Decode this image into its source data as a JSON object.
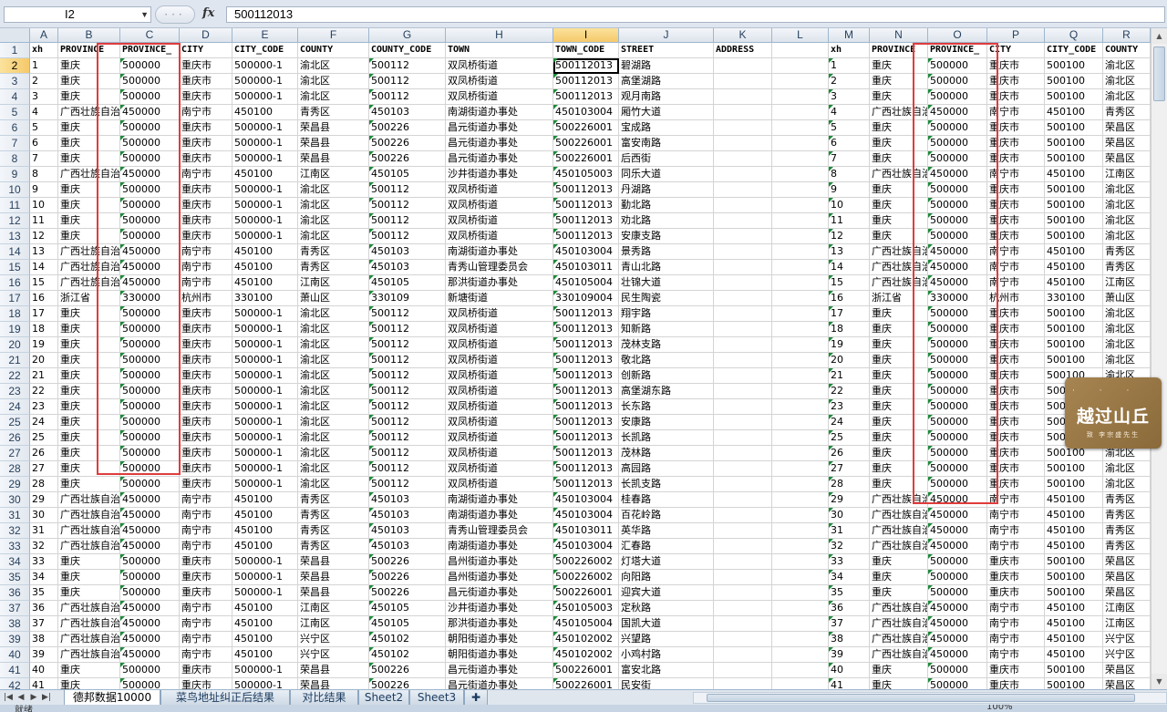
{
  "formula_bar": {
    "name_box": "I2",
    "fx": "fx",
    "formula": "500112013"
  },
  "columns_left": [
    "A",
    "B",
    "C",
    "D",
    "E",
    "F",
    "G",
    "H",
    "I",
    "J",
    "K",
    "L"
  ],
  "columns_right": [
    "M",
    "N",
    "O",
    "P",
    "Q",
    "R"
  ],
  "left_headers": [
    "xh",
    "PROVINCE",
    "PROVINCE_",
    "CITY",
    "CITY_CODE",
    "COUNTY",
    "COUNTY_CODE",
    "TOWN",
    "TOWN_CODE",
    "STREET",
    "ADDRESS",
    ""
  ],
  "right_headers": [
    "xh",
    "PROVINCE",
    "PROVINCE_",
    "CITY",
    "CITY_CODE",
    "COUNTY"
  ],
  "rows_left": [
    [
      "1",
      "重庆",
      "500000",
      "重庆市",
      "500000-1",
      "渝北区",
      "500112",
      "双凤桥街道",
      "500112013",
      "碧湖路"
    ],
    [
      "2",
      "重庆",
      "500000",
      "重庆市",
      "500000-1",
      "渝北区",
      "500112",
      "双凤桥街道",
      "500112013",
      "高堡湖路"
    ],
    [
      "3",
      "重庆",
      "500000",
      "重庆市",
      "500000-1",
      "渝北区",
      "500112",
      "双凤桥街道",
      "500112013",
      "观月南路"
    ],
    [
      "4",
      "广西壮族自治区",
      "450000",
      "南宁市",
      "450100",
      "青秀区",
      "450103",
      "南湖街道办事处",
      "450103004",
      "厢竹大道"
    ],
    [
      "5",
      "重庆",
      "500000",
      "重庆市",
      "500000-1",
      "荣昌县",
      "500226",
      "昌元街道办事处",
      "500226001",
      "宝成路"
    ],
    [
      "6",
      "重庆",
      "500000",
      "重庆市",
      "500000-1",
      "荣昌县",
      "500226",
      "昌元街道办事处",
      "500226001",
      "富安南路"
    ],
    [
      "7",
      "重庆",
      "500000",
      "重庆市",
      "500000-1",
      "荣昌县",
      "500226",
      "昌元街道办事处",
      "500226001",
      "后西街"
    ],
    [
      "8",
      "广西壮族自治区",
      "450000",
      "南宁市",
      "450100",
      "江南区",
      "450105",
      "沙井街道办事处",
      "450105003",
      "同乐大道"
    ],
    [
      "9",
      "重庆",
      "500000",
      "重庆市",
      "500000-1",
      "渝北区",
      "500112",
      "双凤桥街道",
      "500112013",
      "丹湖路"
    ],
    [
      "10",
      "重庆",
      "500000",
      "重庆市",
      "500000-1",
      "渝北区",
      "500112",
      "双凤桥街道",
      "500112013",
      "勤北路"
    ],
    [
      "11",
      "重庆",
      "500000",
      "重庆市",
      "500000-1",
      "渝北区",
      "500112",
      "双凤桥街道",
      "500112013",
      "劝北路"
    ],
    [
      "12",
      "重庆",
      "500000",
      "重庆市",
      "500000-1",
      "渝北区",
      "500112",
      "双凤桥街道",
      "500112013",
      "安康支路"
    ],
    [
      "13",
      "广西壮族自治区",
      "450000",
      "南宁市",
      "450100",
      "青秀区",
      "450103",
      "南湖街道办事处",
      "450103004",
      "景秀路"
    ],
    [
      "14",
      "广西壮族自治区",
      "450000",
      "南宁市",
      "450100",
      "青秀区",
      "450103",
      "青秀山管理委员会",
      "450103011",
      "青山北路"
    ],
    [
      "15",
      "广西壮族自治区",
      "450000",
      "南宁市",
      "450100",
      "江南区",
      "450105",
      "那洪街道办事处",
      "450105004",
      "壮锦大道"
    ],
    [
      "16",
      "浙江省",
      "330000",
      "杭州市",
      "330100",
      "萧山区",
      "330109",
      "新塘街道",
      "330109004",
      "民生陶瓷"
    ],
    [
      "17",
      "重庆",
      "500000",
      "重庆市",
      "500000-1",
      "渝北区",
      "500112",
      "双凤桥街道",
      "500112013",
      "翔宇路"
    ],
    [
      "18",
      "重庆",
      "500000",
      "重庆市",
      "500000-1",
      "渝北区",
      "500112",
      "双凤桥街道",
      "500112013",
      "知新路"
    ],
    [
      "19",
      "重庆",
      "500000",
      "重庆市",
      "500000-1",
      "渝北区",
      "500112",
      "双凤桥街道",
      "500112013",
      "茂林支路"
    ],
    [
      "20",
      "重庆",
      "500000",
      "重庆市",
      "500000-1",
      "渝北区",
      "500112",
      "双凤桥街道",
      "500112013",
      "敬北路"
    ],
    [
      "21",
      "重庆",
      "500000",
      "重庆市",
      "500000-1",
      "渝北区",
      "500112",
      "双凤桥街道",
      "500112013",
      "创新路"
    ],
    [
      "22",
      "重庆",
      "500000",
      "重庆市",
      "500000-1",
      "渝北区",
      "500112",
      "双凤桥街道",
      "500112013",
      "高堡湖东路"
    ],
    [
      "23",
      "重庆",
      "500000",
      "重庆市",
      "500000-1",
      "渝北区",
      "500112",
      "双凤桥街道",
      "500112013",
      "长东路"
    ],
    [
      "24",
      "重庆",
      "500000",
      "重庆市",
      "500000-1",
      "渝北区",
      "500112",
      "双凤桥街道",
      "500112013",
      "安康路"
    ],
    [
      "25",
      "重庆",
      "500000",
      "重庆市",
      "500000-1",
      "渝北区",
      "500112",
      "双凤桥街道",
      "500112013",
      "长凯路"
    ],
    [
      "26",
      "重庆",
      "500000",
      "重庆市",
      "500000-1",
      "渝北区",
      "500112",
      "双凤桥街道",
      "500112013",
      "茂林路"
    ],
    [
      "27",
      "重庆",
      "500000",
      "重庆市",
      "500000-1",
      "渝北区",
      "500112",
      "双凤桥街道",
      "500112013",
      "高园路"
    ],
    [
      "28",
      "重庆",
      "500000",
      "重庆市",
      "500000-1",
      "渝北区",
      "500112",
      "双凤桥街道",
      "500112013",
      "长凯支路"
    ],
    [
      "29",
      "广西壮族自治区",
      "450000",
      "南宁市",
      "450100",
      "青秀区",
      "450103",
      "南湖街道办事处",
      "450103004",
      "桂春路"
    ],
    [
      "30",
      "广西壮族自治区",
      "450000",
      "南宁市",
      "450100",
      "青秀区",
      "450103",
      "南湖街道办事处",
      "450103004",
      "百花岭路"
    ],
    [
      "31",
      "广西壮族自治区",
      "450000",
      "南宁市",
      "450100",
      "青秀区",
      "450103",
      "青秀山管理委员会",
      "450103011",
      "英华路"
    ],
    [
      "32",
      "广西壮族自治区",
      "450000",
      "南宁市",
      "450100",
      "青秀区",
      "450103",
      "南湖街道办事处",
      "450103004",
      "汇春路"
    ],
    [
      "33",
      "重庆",
      "500000",
      "重庆市",
      "500000-1",
      "荣昌县",
      "500226",
      "昌州街道办事处",
      "500226002",
      "灯塔大道"
    ],
    [
      "34",
      "重庆",
      "500000",
      "重庆市",
      "500000-1",
      "荣昌县",
      "500226",
      "昌州街道办事处",
      "500226002",
      "向阳路"
    ],
    [
      "35",
      "重庆",
      "500000",
      "重庆市",
      "500000-1",
      "荣昌县",
      "500226",
      "昌元街道办事处",
      "500226001",
      "迎宾大道"
    ],
    [
      "36",
      "广西壮族自治区",
      "450000",
      "南宁市",
      "450100",
      "江南区",
      "450105",
      "沙井街道办事处",
      "450105003",
      "定秋路"
    ],
    [
      "37",
      "广西壮族自治区",
      "450000",
      "南宁市",
      "450100",
      "江南区",
      "450105",
      "那洪街道办事处",
      "450105004",
      "国凯大道"
    ],
    [
      "38",
      "广西壮族自治区",
      "450000",
      "南宁市",
      "450100",
      "兴宁区",
      "450102",
      "朝阳街道办事处",
      "450102002",
      "兴望路"
    ],
    [
      "39",
      "广西壮族自治区",
      "450000",
      "南宁市",
      "450100",
      "兴宁区",
      "450102",
      "朝阳街道办事处",
      "450102002",
      "小鸡村路"
    ],
    [
      "40",
      "重庆",
      "500000",
      "重庆市",
      "500000-1",
      "荣昌县",
      "500226",
      "昌元街道办事处",
      "500226001",
      "富安北路"
    ],
    [
      "41",
      "重庆",
      "500000",
      "重庆市",
      "500000-1",
      "荣昌县",
      "500226",
      "昌元街道办事处",
      "500226001",
      "民安街"
    ]
  ],
  "rows_right": [
    [
      "1",
      "重庆",
      "500000",
      "重庆市",
      "500100",
      "渝北区"
    ],
    [
      "2",
      "重庆",
      "500000",
      "重庆市",
      "500100",
      "渝北区"
    ],
    [
      "3",
      "重庆",
      "500000",
      "重庆市",
      "500100",
      "渝北区"
    ],
    [
      "4",
      "广西壮族自治区",
      "450000",
      "南宁市",
      "450100",
      "青秀区"
    ],
    [
      "5",
      "重庆",
      "500000",
      "重庆市",
      "500100",
      "荣昌区"
    ],
    [
      "6",
      "重庆",
      "500000",
      "重庆市",
      "500100",
      "荣昌区"
    ],
    [
      "7",
      "重庆",
      "500000",
      "重庆市",
      "500100",
      "荣昌区"
    ],
    [
      "8",
      "广西壮族自治区",
      "450000",
      "南宁市",
      "450100",
      "江南区"
    ],
    [
      "9",
      "重庆",
      "500000",
      "重庆市",
      "500100",
      "渝北区"
    ],
    [
      "10",
      "重庆",
      "500000",
      "重庆市",
      "500100",
      "渝北区"
    ],
    [
      "11",
      "重庆",
      "500000",
      "重庆市",
      "500100",
      "渝北区"
    ],
    [
      "12",
      "重庆",
      "500000",
      "重庆市",
      "500100",
      "渝北区"
    ],
    [
      "13",
      "广西壮族自治区",
      "450000",
      "南宁市",
      "450100",
      "青秀区"
    ],
    [
      "14",
      "广西壮族自治区",
      "450000",
      "南宁市",
      "450100",
      "青秀区"
    ],
    [
      "15",
      "广西壮族自治区",
      "450000",
      "南宁市",
      "450100",
      "江南区"
    ],
    [
      "16",
      "浙江省",
      "330000",
      "杭州市",
      "330100",
      "萧山区"
    ],
    [
      "17",
      "重庆",
      "500000",
      "重庆市",
      "500100",
      "渝北区"
    ],
    [
      "18",
      "重庆",
      "500000",
      "重庆市",
      "500100",
      "渝北区"
    ],
    [
      "19",
      "重庆",
      "500000",
      "重庆市",
      "500100",
      "渝北区"
    ],
    [
      "20",
      "重庆",
      "500000",
      "重庆市",
      "500100",
      "渝北区"
    ],
    [
      "21",
      "重庆",
      "500000",
      "重庆市",
      "500100",
      "渝北区"
    ],
    [
      "22",
      "重庆",
      "500000",
      "重庆市",
      "500",
      "渝北区"
    ],
    [
      "23",
      "重庆",
      "500000",
      "重庆市",
      "500",
      "渝北区"
    ],
    [
      "24",
      "重庆",
      "500000",
      "重庆市",
      "500",
      "渝北区"
    ],
    [
      "25",
      "重庆",
      "500000",
      "重庆市",
      "500",
      "渝北区"
    ],
    [
      "26",
      "重庆",
      "500000",
      "重庆市",
      "500100",
      "渝北区"
    ],
    [
      "27",
      "重庆",
      "500000",
      "重庆市",
      "500100",
      "渝北区"
    ],
    [
      "28",
      "重庆",
      "500000",
      "重庆市",
      "500100",
      "渝北区"
    ],
    [
      "29",
      "广西壮族自治区",
      "450000",
      "南宁市",
      "450100",
      "青秀区"
    ],
    [
      "30",
      "广西壮族自治区",
      "450000",
      "南宁市",
      "450100",
      "青秀区"
    ],
    [
      "31",
      "广西壮族自治区",
      "450000",
      "南宁市",
      "450100",
      "青秀区"
    ],
    [
      "32",
      "广西壮族自治区",
      "450000",
      "南宁市",
      "450100",
      "青秀区"
    ],
    [
      "33",
      "重庆",
      "500000",
      "重庆市",
      "500100",
      "荣昌区"
    ],
    [
      "34",
      "重庆",
      "500000",
      "重庆市",
      "500100",
      "荣昌区"
    ],
    [
      "35",
      "重庆",
      "500000",
      "重庆市",
      "500100",
      "荣昌区"
    ],
    [
      "36",
      "广西壮族自治区",
      "450000",
      "南宁市",
      "450100",
      "江南区"
    ],
    [
      "37",
      "广西壮族自治区",
      "450000",
      "南宁市",
      "450100",
      "江南区"
    ],
    [
      "38",
      "广西壮族自治区",
      "450000",
      "南宁市",
      "450100",
      "兴宁区"
    ],
    [
      "39",
      "广西壮族自治区",
      "450000",
      "南宁市",
      "450100",
      "兴宁区"
    ],
    [
      "40",
      "重庆",
      "500000",
      "重庆市",
      "500100",
      "荣昌区"
    ],
    [
      "41",
      "重庆",
      "500000",
      "重庆市",
      "500100",
      "荣昌区"
    ]
  ],
  "selected_cell": {
    "col": "I",
    "row": 2
  },
  "sheet_tabs": [
    "德邦数据10000",
    "菜鸟地址纠正后结果",
    "对比结果",
    "Sheet2",
    "Sheet3"
  ],
  "active_tab": 0,
  "watermark": {
    "top": "· · ·",
    "main": "越过山丘",
    "sub": "致 李宗盛先生"
  },
  "status": {
    "text": "就绪",
    "zoom": "100%"
  },
  "colors": {
    "selection_header": "#f5c96a",
    "highlight_box": "#e03c3c",
    "text_flag": "#1d8a3a"
  }
}
